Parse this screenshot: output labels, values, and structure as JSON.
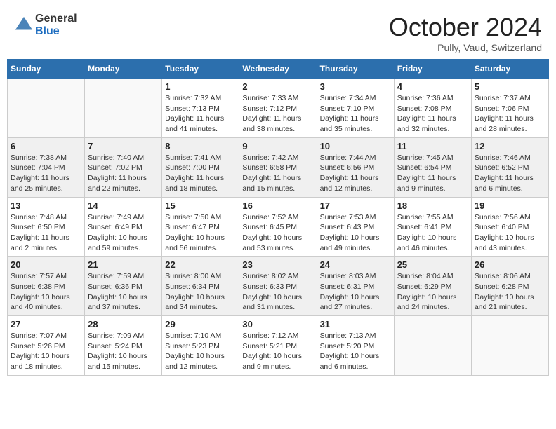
{
  "header": {
    "logo_general": "General",
    "logo_blue": "Blue",
    "month": "October 2024",
    "location": "Pully, Vaud, Switzerland"
  },
  "days_of_week": [
    "Sunday",
    "Monday",
    "Tuesday",
    "Wednesday",
    "Thursday",
    "Friday",
    "Saturday"
  ],
  "weeks": [
    [
      {
        "day": "",
        "info": ""
      },
      {
        "day": "",
        "info": ""
      },
      {
        "day": "1",
        "info": "Sunrise: 7:32 AM\nSunset: 7:13 PM\nDaylight: 11 hours and 41 minutes."
      },
      {
        "day": "2",
        "info": "Sunrise: 7:33 AM\nSunset: 7:12 PM\nDaylight: 11 hours and 38 minutes."
      },
      {
        "day": "3",
        "info": "Sunrise: 7:34 AM\nSunset: 7:10 PM\nDaylight: 11 hours and 35 minutes."
      },
      {
        "day": "4",
        "info": "Sunrise: 7:36 AM\nSunset: 7:08 PM\nDaylight: 11 hours and 32 minutes."
      },
      {
        "day": "5",
        "info": "Sunrise: 7:37 AM\nSunset: 7:06 PM\nDaylight: 11 hours and 28 minutes."
      }
    ],
    [
      {
        "day": "6",
        "info": "Sunrise: 7:38 AM\nSunset: 7:04 PM\nDaylight: 11 hours and 25 minutes."
      },
      {
        "day": "7",
        "info": "Sunrise: 7:40 AM\nSunset: 7:02 PM\nDaylight: 11 hours and 22 minutes."
      },
      {
        "day": "8",
        "info": "Sunrise: 7:41 AM\nSunset: 7:00 PM\nDaylight: 11 hours and 18 minutes."
      },
      {
        "day": "9",
        "info": "Sunrise: 7:42 AM\nSunset: 6:58 PM\nDaylight: 11 hours and 15 minutes."
      },
      {
        "day": "10",
        "info": "Sunrise: 7:44 AM\nSunset: 6:56 PM\nDaylight: 11 hours and 12 minutes."
      },
      {
        "day": "11",
        "info": "Sunrise: 7:45 AM\nSunset: 6:54 PM\nDaylight: 11 hours and 9 minutes."
      },
      {
        "day": "12",
        "info": "Sunrise: 7:46 AM\nSunset: 6:52 PM\nDaylight: 11 hours and 6 minutes."
      }
    ],
    [
      {
        "day": "13",
        "info": "Sunrise: 7:48 AM\nSunset: 6:50 PM\nDaylight: 11 hours and 2 minutes."
      },
      {
        "day": "14",
        "info": "Sunrise: 7:49 AM\nSunset: 6:49 PM\nDaylight: 10 hours and 59 minutes."
      },
      {
        "day": "15",
        "info": "Sunrise: 7:50 AM\nSunset: 6:47 PM\nDaylight: 10 hours and 56 minutes."
      },
      {
        "day": "16",
        "info": "Sunrise: 7:52 AM\nSunset: 6:45 PM\nDaylight: 10 hours and 53 minutes."
      },
      {
        "day": "17",
        "info": "Sunrise: 7:53 AM\nSunset: 6:43 PM\nDaylight: 10 hours and 49 minutes."
      },
      {
        "day": "18",
        "info": "Sunrise: 7:55 AM\nSunset: 6:41 PM\nDaylight: 10 hours and 46 minutes."
      },
      {
        "day": "19",
        "info": "Sunrise: 7:56 AM\nSunset: 6:40 PM\nDaylight: 10 hours and 43 minutes."
      }
    ],
    [
      {
        "day": "20",
        "info": "Sunrise: 7:57 AM\nSunset: 6:38 PM\nDaylight: 10 hours and 40 minutes."
      },
      {
        "day": "21",
        "info": "Sunrise: 7:59 AM\nSunset: 6:36 PM\nDaylight: 10 hours and 37 minutes."
      },
      {
        "day": "22",
        "info": "Sunrise: 8:00 AM\nSunset: 6:34 PM\nDaylight: 10 hours and 34 minutes."
      },
      {
        "day": "23",
        "info": "Sunrise: 8:02 AM\nSunset: 6:33 PM\nDaylight: 10 hours and 31 minutes."
      },
      {
        "day": "24",
        "info": "Sunrise: 8:03 AM\nSunset: 6:31 PM\nDaylight: 10 hours and 27 minutes."
      },
      {
        "day": "25",
        "info": "Sunrise: 8:04 AM\nSunset: 6:29 PM\nDaylight: 10 hours and 24 minutes."
      },
      {
        "day": "26",
        "info": "Sunrise: 8:06 AM\nSunset: 6:28 PM\nDaylight: 10 hours and 21 minutes."
      }
    ],
    [
      {
        "day": "27",
        "info": "Sunrise: 7:07 AM\nSunset: 5:26 PM\nDaylight: 10 hours and 18 minutes."
      },
      {
        "day": "28",
        "info": "Sunrise: 7:09 AM\nSunset: 5:24 PM\nDaylight: 10 hours and 15 minutes."
      },
      {
        "day": "29",
        "info": "Sunrise: 7:10 AM\nSunset: 5:23 PM\nDaylight: 10 hours and 12 minutes."
      },
      {
        "day": "30",
        "info": "Sunrise: 7:12 AM\nSunset: 5:21 PM\nDaylight: 10 hours and 9 minutes."
      },
      {
        "day": "31",
        "info": "Sunrise: 7:13 AM\nSunset: 5:20 PM\nDaylight: 10 hours and 6 minutes."
      },
      {
        "day": "",
        "info": ""
      },
      {
        "day": "",
        "info": ""
      }
    ]
  ]
}
